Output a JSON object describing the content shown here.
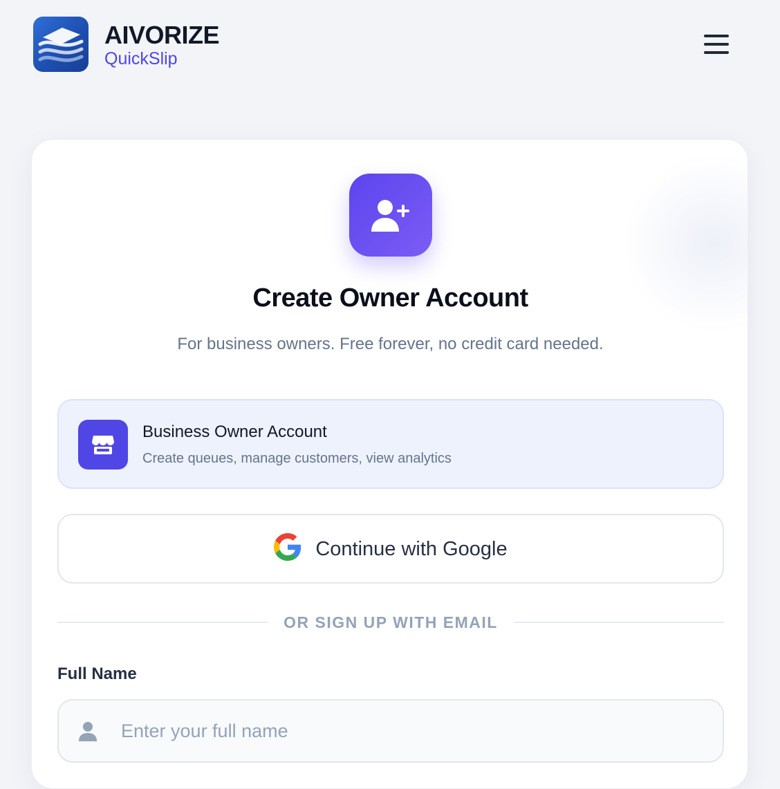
{
  "brand": {
    "name": "AIVORIZE",
    "product": "QuickSlip"
  },
  "header": {
    "menu_icon": "hamburger-menu-icon"
  },
  "hero": {
    "icon": "user-plus-icon",
    "title": "Create Owner Account",
    "subtitle": "For business owners. Free forever, no credit card needed."
  },
  "account_type": {
    "icon": "store-icon",
    "title": "Business Owner Account",
    "description": "Create queues, manage customers, view analytics"
  },
  "google": {
    "icon": "google-icon",
    "label": "Continue with Google"
  },
  "divider": {
    "text": "OR SIGN UP WITH EMAIL"
  },
  "form": {
    "full_name": {
      "label": "Full Name",
      "icon": "user-icon",
      "placeholder": "Enter your full name",
      "value": ""
    }
  },
  "colors": {
    "accent": "#5046e5",
    "brand_blue": "#2f6fd8",
    "background": "#f3f4f8"
  }
}
